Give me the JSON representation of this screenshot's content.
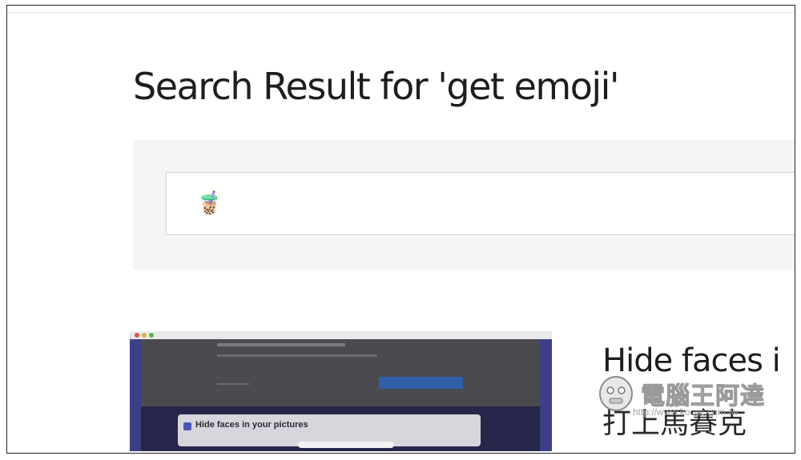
{
  "page": {
    "title": "Search Result for 'get emoji'"
  },
  "search": {
    "value": "🧋"
  },
  "result": {
    "title": "Hide faces i",
    "subtitle": "打上馬賽克",
    "thumbnail": {
      "card_text": "Hide faces in your pictures"
    }
  },
  "watermark": {
    "text": "電腦王阿達",
    "url": "http://www.kocpc.com.tw"
  },
  "colors": {
    "thumb_border": "#3c3f86",
    "thumb_button": "#2f5fa8",
    "panel_bg": "#f5f5f5"
  }
}
